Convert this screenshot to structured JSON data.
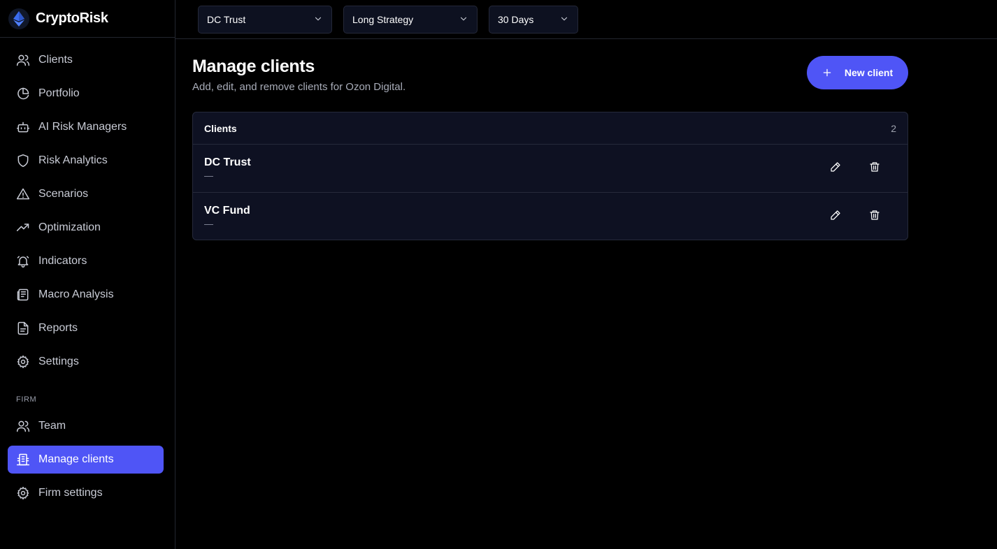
{
  "app": {
    "name": "CryptoRisk"
  },
  "sidebar": {
    "main_items": [
      {
        "label": "Clients",
        "icon": "users-icon"
      },
      {
        "label": "Portfolio",
        "icon": "pie-chart-icon"
      },
      {
        "label": "AI Risk Managers",
        "icon": "bot-icon"
      },
      {
        "label": "Risk Analytics",
        "icon": "shield-icon"
      },
      {
        "label": "Scenarios",
        "icon": "warning-icon"
      },
      {
        "label": "Optimization",
        "icon": "trending-up-icon"
      },
      {
        "label": "Indicators",
        "icon": "bell-icon"
      },
      {
        "label": "Macro Analysis",
        "icon": "newspaper-icon"
      },
      {
        "label": "Reports",
        "icon": "file-text-icon"
      },
      {
        "label": "Settings",
        "icon": "gear-icon"
      }
    ],
    "firm_label": "FIRM",
    "firm_items": [
      {
        "label": "Team",
        "icon": "users-icon"
      },
      {
        "label": "Manage clients",
        "icon": "building-icon",
        "active": true
      },
      {
        "label": "Firm settings",
        "icon": "gear-icon"
      }
    ]
  },
  "topbar": {
    "client_select": "DC Trust",
    "strategy_select": "Long Strategy",
    "period_select": "30 Days"
  },
  "main": {
    "title": "Manage clients",
    "subtitle": "Add, edit, and remove clients for Ozon Digital.",
    "new_button_label": "New client"
  },
  "clients_table": {
    "title": "Clients",
    "count": "2",
    "rows": [
      {
        "name": "DC Trust",
        "sub": "—"
      },
      {
        "name": "VC Fund",
        "sub": "—"
      }
    ]
  },
  "colors": {
    "accent": "#4f55f6",
    "background": "#000000",
    "card": "#0e1122"
  }
}
